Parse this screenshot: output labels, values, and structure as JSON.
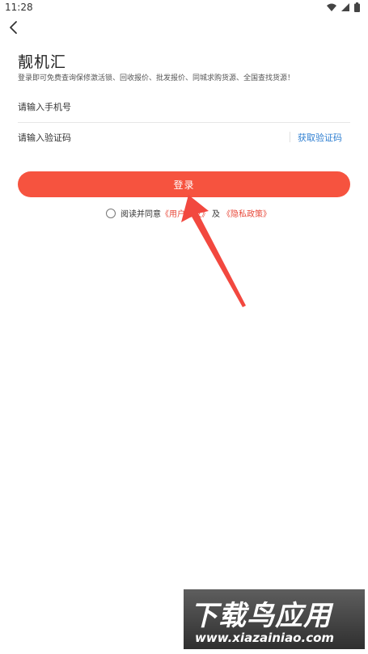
{
  "status_bar": {
    "time": "11:28"
  },
  "header": {
    "back_icon": "chevron-left-icon"
  },
  "main": {
    "title": "靓机汇",
    "subtitle": "登录即可免费查询保修激活锁、回收报价、批发报价、同城求购货源、全国查找货源！"
  },
  "form": {
    "phone_placeholder": "请输入手机号",
    "code_placeholder": "请输入验证码",
    "get_code_label": "获取验证码",
    "login_label": "登录"
  },
  "agreement": {
    "prefix": "阅读并同意",
    "user_agreement": "《用户协议》",
    "joiner": "及",
    "privacy_policy": "《隐私政策》"
  },
  "watermark": {
    "title": "下载鸟应用",
    "url": "www.xiazainiao.com"
  },
  "colors": {
    "accent": "#f6533f",
    "link": "#2f7fd1",
    "agreement_link": "#e84a3b",
    "annotation_arrow": "#f2483f"
  }
}
